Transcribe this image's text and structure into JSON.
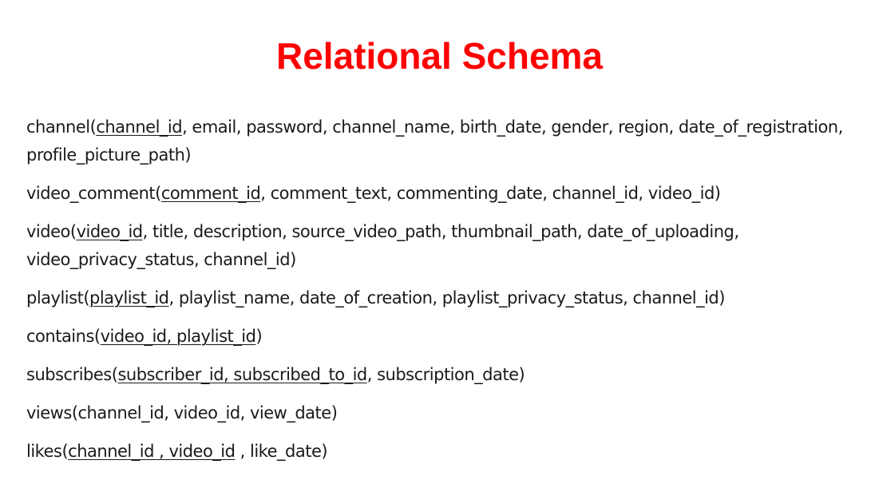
{
  "title": "Relational Schema",
  "relations": [
    {
      "name": "channel",
      "open": "(",
      "key": "channel_id",
      "rest": ", email, password, channel_name, birth_date, gender, region, date_of_registration, profile_picture_path)"
    },
    {
      "name": "video_comment",
      "open": "(",
      "key": "comment_id",
      "rest": ", comment_text, commenting_date, channel_id, video_id)"
    },
    {
      "name": "video",
      "open": "(",
      "key": "video_id",
      "rest": ", title, description, source_video_path, thumbnail_path, date_of_uploading, video_privacy_status, channel_id)"
    },
    {
      "name": "playlist",
      "open": "(",
      "key": "playlist_id",
      "rest": ", playlist_name, date_of_creation, playlist_privacy_status, channel_id)"
    },
    {
      "name": "contains",
      "open": "(",
      "key": "video_id, playlist_id",
      "rest": ")"
    },
    {
      "name": "subscribes",
      "open": "(",
      "key": "subscriber_id, subscribed_to_id",
      "rest": ", subscription_date)"
    },
    {
      "name": "views",
      "open": "",
      "key": "",
      "rest": "(channel_id, video_id, view_date)"
    },
    {
      "name": "likes",
      "open": "(",
      "key": "channel_id , video_id",
      "rest": " , like_date)"
    }
  ]
}
